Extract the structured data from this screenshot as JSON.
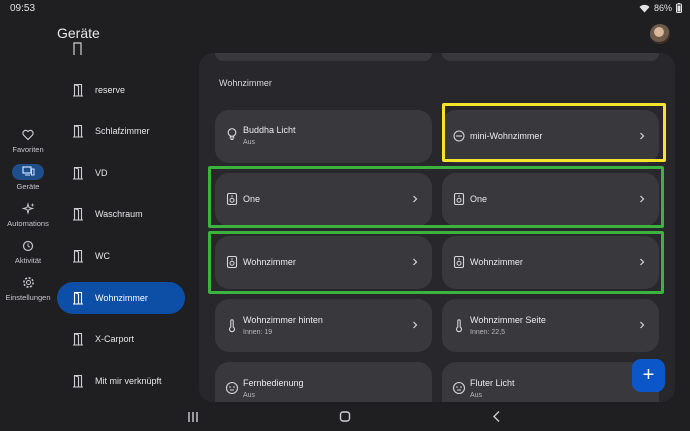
{
  "status": {
    "time": "09:53",
    "battery": "86%"
  },
  "app": {
    "title": "Geräte"
  },
  "rail": [
    {
      "label": "Favoriten",
      "icon": "heart-icon"
    },
    {
      "label": "Geräte",
      "icon": "devices-icon",
      "active": true
    },
    {
      "label": "Automations",
      "icon": "sparkle-icon"
    },
    {
      "label": "Aktivität",
      "icon": "history-icon"
    },
    {
      "label": "Einstellungen",
      "icon": "gear-icon"
    }
  ],
  "rooms": [
    {
      "label": "reserve"
    },
    {
      "label": "Schlafzimmer"
    },
    {
      "label": "VD"
    },
    {
      "label": "Waschraum"
    },
    {
      "label": "WC"
    },
    {
      "label": "Wohnzimmer",
      "active": true
    },
    {
      "label": "X-Carport"
    },
    {
      "label": "Mit mir verknüpft"
    }
  ],
  "section": {
    "title": "Wohnzimmer"
  },
  "cards": [
    {
      "name": "Buddha Licht",
      "sub": "Aus",
      "icon": "bulb-icon",
      "chevron": false
    },
    {
      "name": "mini-Wohnzimmer",
      "sub": "",
      "icon": "hub-icon",
      "chevron": true
    },
    {
      "name": "One",
      "sub": "",
      "icon": "speaker-icon",
      "chevron": true
    },
    {
      "name": "One",
      "sub": "",
      "icon": "speaker-icon",
      "chevron": true
    },
    {
      "name": "Wohnzimmer",
      "sub": "",
      "icon": "speaker-icon",
      "chevron": true
    },
    {
      "name": "Wohnzimmer",
      "sub": "",
      "icon": "speaker-icon",
      "chevron": true
    },
    {
      "name": "Wohnzimmer hinten",
      "sub": "Innen: 19",
      "icon": "thermometer-icon",
      "chevron": true
    },
    {
      "name": "Wohnzimmer Seite",
      "sub": "Innen: 22,5",
      "icon": "thermometer-icon",
      "chevron": true
    },
    {
      "name": "Fernbedienung",
      "sub": "Aus",
      "icon": "remote-icon",
      "chevron": false
    },
    {
      "name": "Fluter Licht",
      "sub": "Aus",
      "icon": "remote-icon",
      "chevron": false
    }
  ],
  "fab": {
    "label": "+"
  }
}
